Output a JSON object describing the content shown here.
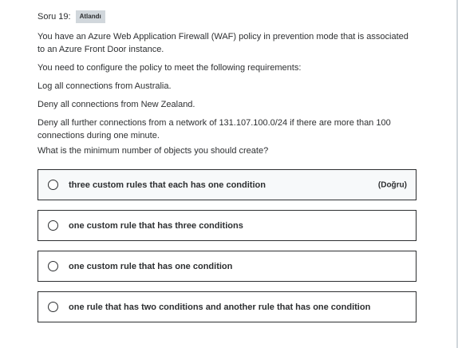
{
  "question": {
    "label": "Soru 19:",
    "badge": "Atlandı",
    "stem": [
      "You have an Azure Web Application Firewall (WAF) policy in prevention mode that is associated to an Azure Front Door instance.",
      "You need to configure the policy to meet the following requirements:",
      "Log all connections from Australia.",
      "Deny all connections from New Zealand.",
      "Deny all further connections from a network of 131.107.100.0/24 if there are more than 100 connections during one minute.",
      "What is the minimum number of objects you should create?"
    ]
  },
  "options": [
    {
      "text": "three custom rules that each has one condition",
      "tag": "(Doğru)"
    },
    {
      "text": "one custom rule that has three conditions"
    },
    {
      "text": "one custom rule that has one condition"
    },
    {
      "text": "one rule that has two conditions and another rule that has one condition"
    }
  ]
}
